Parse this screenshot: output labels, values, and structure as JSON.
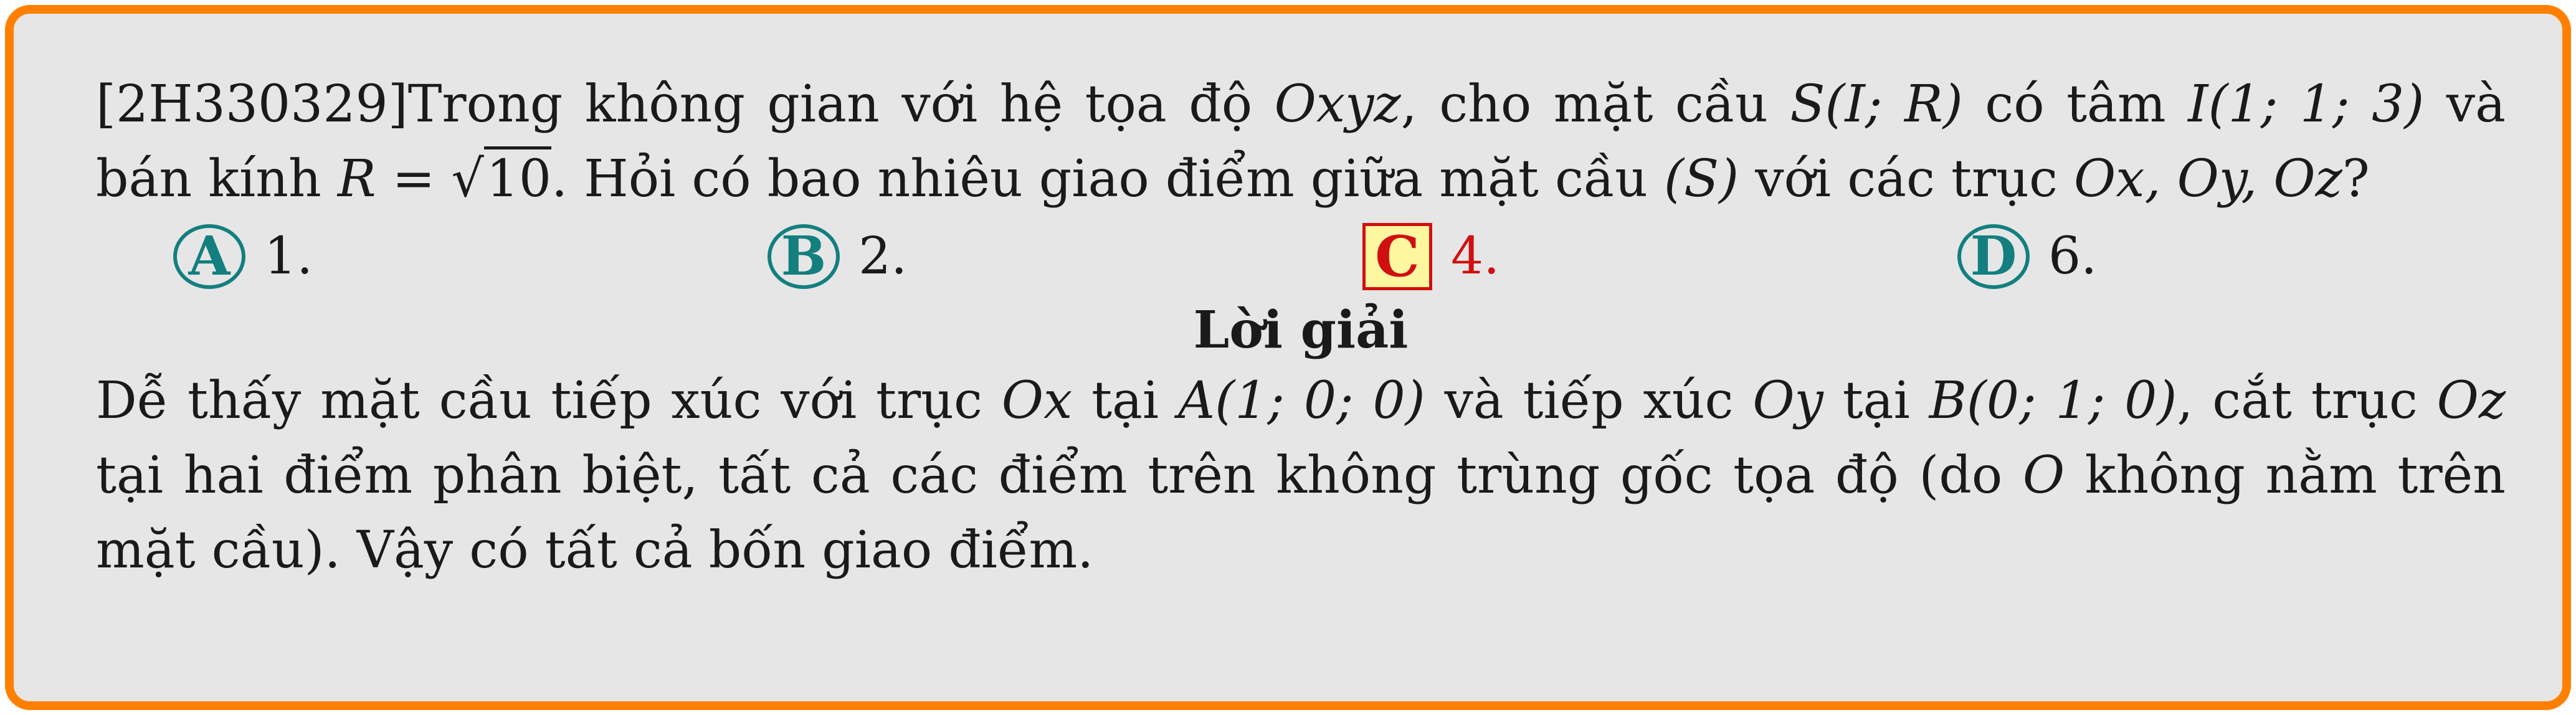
{
  "question": {
    "code": "[2H330329]",
    "text_1": "Trong không gian với hệ tọa độ ",
    "m_oxyz": "Oxyz",
    "text_2": ", cho mặt cầu ",
    "m_sir": "S(I; R)",
    "text_3": " có tâm ",
    "m_center": "I(1; 1; 3)",
    "text_4": " và bán kính ",
    "m_r_eq": "R = ",
    "sqrt_symbol": "√",
    "sqrt_value": "10",
    "text_5": ". Hỏi có bao nhiêu giao điểm giữa mặt cầu ",
    "m_s": "(S)",
    "text_6": " với các trục ",
    "m_axes": "Ox, Oy, Oz",
    "text_7": "?"
  },
  "choices": [
    {
      "letter": "A",
      "text": "1.",
      "correct": false
    },
    {
      "letter": "B",
      "text": "2.",
      "correct": false
    },
    {
      "letter": "C",
      "text": "4.",
      "correct": true
    },
    {
      "letter": "D",
      "text": "6.",
      "correct": false
    }
  ],
  "solution": {
    "heading": "Lời giải",
    "t1": "Dễ thấy mặt cầu tiếp xúc với trục ",
    "m_ox": "Ox",
    "t2": " tại ",
    "m_a": "A(1; 0; 0)",
    "t3": " và tiếp xúc ",
    "m_oy": "Oy",
    "t4": " tại ",
    "m_b": "B(0; 1; 0)",
    "t5": ", cắt trục ",
    "m_oz": "Oz",
    "t6": " tại hai điểm phân biệt, tất cả các điểm trên không trùng gốc tọa độ (do ",
    "m_o": "O",
    "t7": " không nằm trên mặt cầu). Vậy có tất cả bốn giao điểm."
  },
  "colors": {
    "frame_border": "#ff8000",
    "background": "#e6e6e6",
    "badge_teal": "#137f7f",
    "correct_red": "#d01010",
    "correct_fill": "#fff6a0"
  }
}
